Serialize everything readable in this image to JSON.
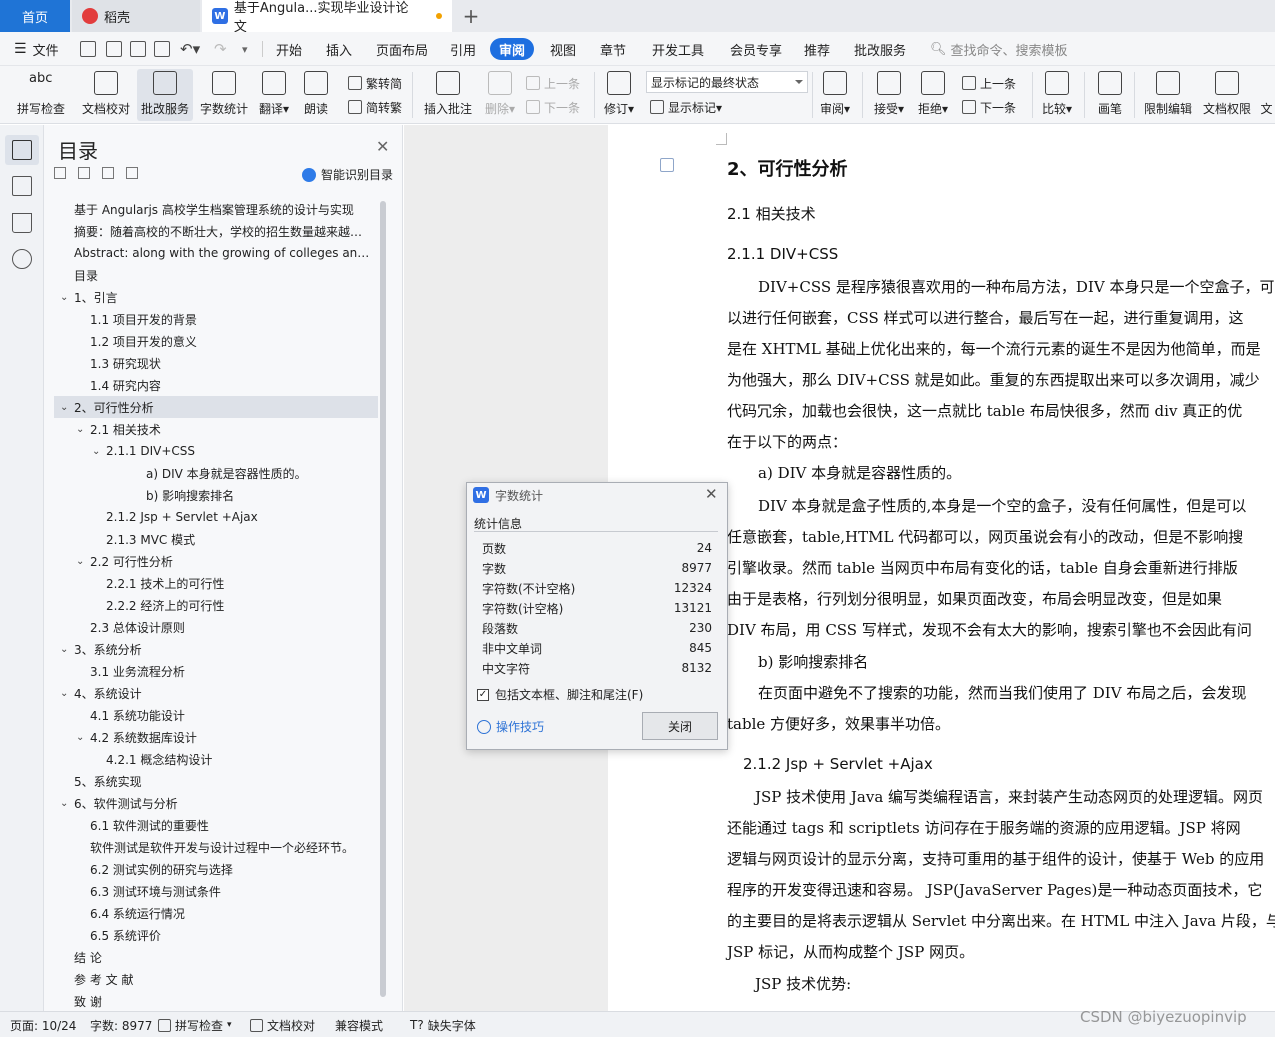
{
  "tabs": {
    "home": "首页",
    "daoke": "稻壳",
    "doc": "基于Angula...实现毕业设计论文"
  },
  "menu": {
    "file": "文件",
    "items": [
      "开始",
      "插入",
      "页面布局",
      "引用",
      "审阅",
      "视图",
      "章节",
      "开发工具",
      "会员专享",
      "推荐",
      "批改服务"
    ],
    "active_index": 4,
    "search": "查找命令、搜索模板"
  },
  "ribbon": {
    "spell": "拼写检查",
    "proof": "文档校对",
    "correct": "批改服务",
    "wordcount": "字数统计",
    "translate": "翻译",
    "read": "朗读",
    "s2t": "繁转简",
    "t2s": "简转繁",
    "insert_comment": "插入批注",
    "delete": "删除",
    "prev": "上一条",
    "next": "下一条",
    "revise": "修订",
    "markup_combo": "显示标记的最终状态",
    "show_markup": "显示标记",
    "review": "审阅",
    "accept": "接受",
    "reject": "拒绝",
    "prev2": "上一条",
    "next2": "下一条",
    "compare": "比较",
    "pen": "画笔",
    "restrict": "限制编辑",
    "perm": "文档权限",
    "more": "文"
  },
  "toc": {
    "title": "目录",
    "smart": "智能识别目录",
    "items": [
      {
        "text": "基于 Angularjs 高校学生档案管理系统的设计与实现",
        "level": 0,
        "chev": ""
      },
      {
        "text": "摘要：随着高校的不断壮大，学校的招生数量越来越多，学生档案的管理",
        "level": 0,
        "chev": ""
      },
      {
        "text": "Abstract: along with the growing of colleges and universities",
        "level": 0,
        "chev": ""
      },
      {
        "text": "目录",
        "level": 0,
        "chev": ""
      },
      {
        "text": "1、引言",
        "level": 0,
        "chev": "v"
      },
      {
        "text": "1.1 项目开发的背景",
        "level": 1,
        "chev": ""
      },
      {
        "text": "1.2 项目开发的意义",
        "level": 1,
        "chev": ""
      },
      {
        "text": "1.3 研究现状",
        "level": 1,
        "chev": ""
      },
      {
        "text": "1.4 研究内容",
        "level": 1,
        "chev": ""
      },
      {
        "text": "2、可行性分析",
        "level": 0,
        "chev": "v",
        "selected": true
      },
      {
        "text": "2.1 相关技术",
        "level": 1,
        "chev": "v"
      },
      {
        "text": "2.1.1 DIV+CSS",
        "level": 2,
        "chev": "v"
      },
      {
        "text": "a) DIV 本身就是容器性质的。",
        "level": 4,
        "chev": ""
      },
      {
        "text": "b) 影响搜索排名",
        "level": 4,
        "chev": ""
      },
      {
        "text": "2.1.2 Jsp + Servlet +Ajax",
        "level": 2,
        "chev": ""
      },
      {
        "text": "2.1.3 MVC 模式",
        "level": 2,
        "chev": ""
      },
      {
        "text": "2.2 可行性分析",
        "level": 1,
        "chev": "v"
      },
      {
        "text": "2.2.1 技术上的可行性",
        "level": 2,
        "chev": ""
      },
      {
        "text": "2.2.2 经济上的可行性",
        "level": 2,
        "chev": ""
      },
      {
        "text": "2.3 总体设计原则",
        "level": 1,
        "chev": ""
      },
      {
        "text": "3、系统分析",
        "level": 0,
        "chev": "v"
      },
      {
        "text": "3.1 业务流程分析",
        "level": 1,
        "chev": ""
      },
      {
        "text": "4、系统设计",
        "level": 0,
        "chev": "v"
      },
      {
        "text": "4.1 系统功能设计",
        "level": 1,
        "chev": ""
      },
      {
        "text": "4.2 系统数据库设计",
        "level": 1,
        "chev": "v"
      },
      {
        "text": "4.2.1 概念结构设计",
        "level": 2,
        "chev": ""
      },
      {
        "text": "5、系统实现",
        "level": 0,
        "chev": ""
      },
      {
        "text": "6、软件测试与分析",
        "level": 0,
        "chev": "v"
      },
      {
        "text": "6.1 软件测试的重要性",
        "level": 1,
        "chev": ""
      },
      {
        "text": "软件测试是软件开发与设计过程中一个必经环节。",
        "level": 1,
        "chev": ""
      },
      {
        "text": "6.2 测试实例的研究与选择",
        "level": 1,
        "chev": ""
      },
      {
        "text": "6.3 测试环境与测试条件",
        "level": 1,
        "chev": ""
      },
      {
        "text": "6.4 系统运行情况",
        "level": 1,
        "chev": ""
      },
      {
        "text": "6.5 系统评价",
        "level": 1,
        "chev": ""
      },
      {
        "text": "结  论",
        "level": 0,
        "chev": ""
      },
      {
        "text": "参 考 文 献",
        "level": 0,
        "chev": ""
      },
      {
        "text": "致  谢",
        "level": 0,
        "chev": ""
      }
    ]
  },
  "dialog": {
    "title": "字数统计",
    "subtitle": "统计信息",
    "rows": [
      {
        "label": "页数",
        "value": "24"
      },
      {
        "label": "字数",
        "value": "8977"
      },
      {
        "label": "字符数(不计空格)",
        "value": "12324"
      },
      {
        "label": "字符数(计空格)",
        "value": "13121"
      },
      {
        "label": "段落数",
        "value": "230"
      },
      {
        "label": "非中文单词",
        "value": "845"
      },
      {
        "label": "中文字符",
        "value": "8132"
      }
    ],
    "checkbox": "包括文本框、脚注和尾注(F)",
    "tips": "操作技巧",
    "close": "关闭"
  },
  "doc": {
    "lines": [
      {
        "text": "2、可行性分析",
        "cls": "h2"
      },
      {
        "text": "2.1 相关技术",
        "cls": "h3"
      },
      {
        "text": "2.1.1 DIV+CSS",
        "cls": "h3"
      },
      {
        "text": "DIV+CSS 是程序猿很喜欢用的一种布局方法，DIV 本身只是一个空盒子，可",
        "cls": ""
      },
      {
        "text": "以进行任何嵌套，CSS 样式可以进行整合，最后写在一起，进行重复调用，这",
        "cls": ""
      },
      {
        "text": "是在 XHTML 基础上优化出来的，每一个流行元素的诞生不是因为他简单，而是",
        "cls": ""
      },
      {
        "text": "为他强大，那么 DIV+CSS 就是如此。重复的东西提取出来可以多次调用，减少",
        "cls": ""
      },
      {
        "text": "代码冗余，加载也会很快，这一点就比 table 布局快很多，然而 div 真正的优",
        "cls": ""
      },
      {
        "text": "在于以下的两点：",
        "cls": ""
      },
      {
        "text": "a) DIV 本身就是容器性质的。",
        "cls": ""
      },
      {
        "text": "DIV 本身就是盒子性质的,本身是一个空的盒子，没有任何属性，但是可以",
        "cls": ""
      },
      {
        "text": "任意嵌套，table,HTML 代码都可以，网页虽说会有小的改动，但是不影响搜",
        "cls": ""
      },
      {
        "text": "引擎收录。然而 table 当网页中布局有变化的话，table 自身会重新进行排版",
        "cls": ""
      },
      {
        "text": "由于是表格，行列划分很明显，如果页面改变，布局会明显改变，但是如果",
        "cls": ""
      },
      {
        "text": "DIV 布局，用 CSS 写样式，发现不会有太大的影响，搜索引擎也不会因此有问",
        "cls": ""
      },
      {
        "text": "b) 影响搜索排名",
        "cls": ""
      },
      {
        "text": "在页面中避免不了搜索的功能，然而当我们使用了 DIV 布局之后，会发现",
        "cls": ""
      },
      {
        "text": "table 方便好多，效果事半功倍。",
        "cls": ""
      },
      {
        "text": "2.1.2 Jsp + Servlet +Ajax",
        "cls": "h3"
      },
      {
        "text": "JSP 技术使用 Java 编写类编程语言，来封装产生动态网页的处理逻辑。网页",
        "cls": ""
      },
      {
        "text": "还能通过 tags 和 scriptlets 访问存在于服务端的资源的应用逻辑。JSP 将网",
        "cls": ""
      },
      {
        "text": "逻辑与网页设计的显示分离，支持可重用的基于组件的设计，使基于 Web 的应用",
        "cls": ""
      },
      {
        "text": "程序的开发变得迅速和容易。 JSP(JavaServer Pages)是一种动态页面技术，它",
        "cls": ""
      },
      {
        "text": "的主要目的是将表示逻辑从 Servlet 中分离出来。在 HTML 中注入 Java 片段，与",
        "cls": ""
      },
      {
        "text": "JSP 标记，从而构成整个 JSP 网页。",
        "cls": ""
      },
      {
        "text": "JSP 技术优势:",
        "cls": ""
      }
    ]
  },
  "status": {
    "page": "页面: 10/24",
    "words": "字数: 8977",
    "spell": "拼写检查",
    "proof": "文档校对",
    "compat": "兼容模式",
    "missing_font": "缺失字体"
  },
  "watermark": "CSDN @biyezuopinvip"
}
